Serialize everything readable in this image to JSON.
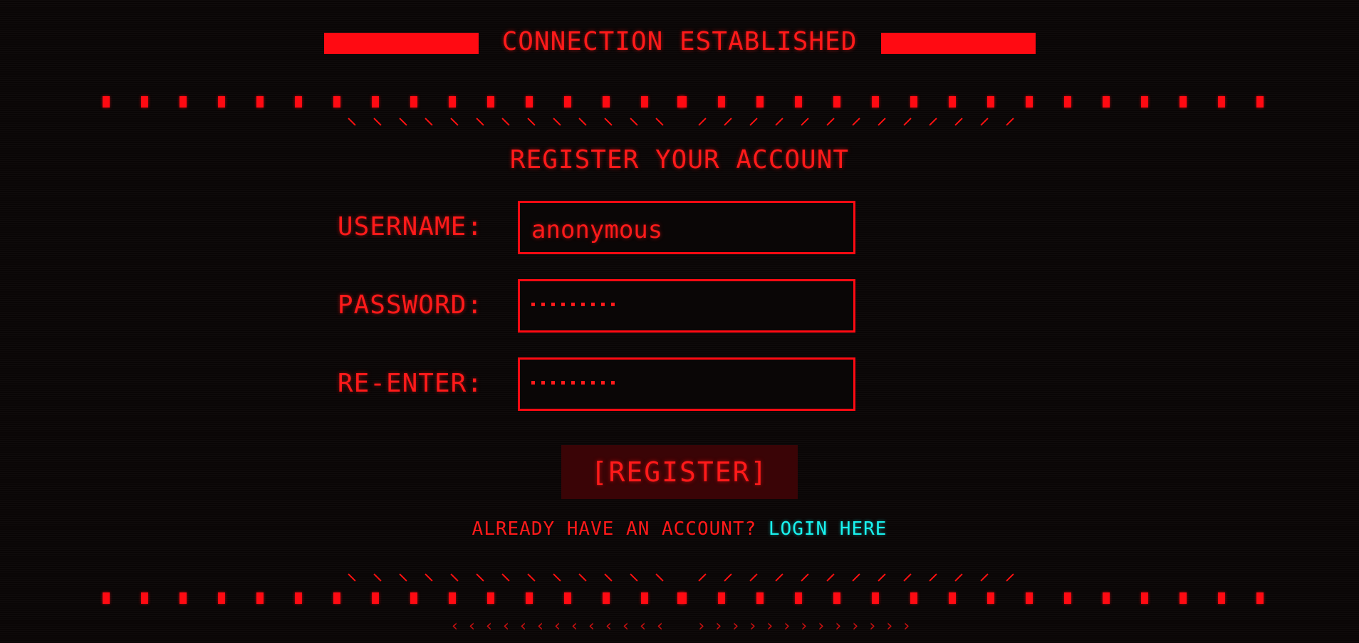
{
  "header": {
    "title": "CONNECTION ESTABLISHED"
  },
  "form": {
    "title": "REGISTER YOUR ACCOUNT",
    "username_label": "USERNAME:",
    "username_value": "anonymous",
    "password_label": "PASSWORD:",
    "password_masked_length": 9,
    "reenter_label": "RE-ENTER:",
    "reenter_masked_length": 9,
    "register_button": "[REGISTER]"
  },
  "footer": {
    "login_prompt": "ALREADY HAVE AN ACCOUNT?",
    "login_link": "LOGIN HERE"
  },
  "colors": {
    "accent": "#ff0a12",
    "link": "#19f3f0",
    "background": "#0a0606",
    "button_bg": "#3a0406"
  }
}
